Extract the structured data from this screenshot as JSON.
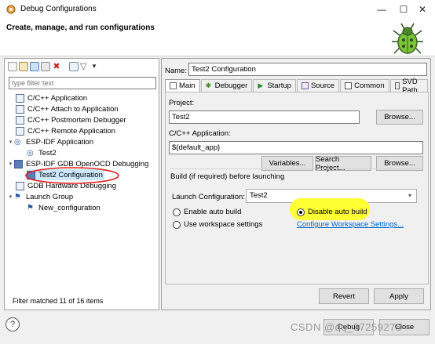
{
  "window": {
    "title": "Debug Configurations",
    "minimize": "—",
    "maximize": "☐",
    "close": "✕"
  },
  "header": {
    "title": "Create, manage, and run configurations"
  },
  "left": {
    "filter_placeholder": "type filter text",
    "tree": [
      {
        "label": "C/C++ Application",
        "level": 1
      },
      {
        "label": "C/C++ Attach to Application",
        "level": 1
      },
      {
        "label": "C/C++ Postmortem Debugger",
        "level": 1
      },
      {
        "label": "C/C++ Remote Application",
        "level": 1
      },
      {
        "label": "ESP-IDF Application",
        "level": 0,
        "expanded": true
      },
      {
        "label": "Test2",
        "level": 1
      },
      {
        "label": "ESP-IDF GDB OpenOCD Debugging",
        "level": 0,
        "expanded": true
      },
      {
        "label": "Test2 Configuration",
        "level": 1,
        "selected": true
      },
      {
        "label": "GDB Hardware Debugging",
        "level": 1
      },
      {
        "label": "Launch Group",
        "level": 0,
        "expanded": true
      },
      {
        "label": "New_configuration",
        "level": 1
      }
    ],
    "filtered_status": "Filter matched 11 of 16 items"
  },
  "right": {
    "name_label": "Name:",
    "name_value": "Test2 Configuration",
    "tabs": [
      "Main",
      "Debugger",
      "Startup",
      "Source",
      "Common",
      "SVD Path"
    ],
    "project_label": "Project:",
    "project_value": "Test2",
    "browse1": "Browse...",
    "app_label": "C/C++ Application:",
    "app_value": "${default_app}",
    "variables": "Variables...",
    "search_project": "Search Project...",
    "browse2": "Browse...",
    "build_label": "Build (if required) before launching",
    "launch_config_label": "Launch Configuration:",
    "launch_config_value": "Test2",
    "radio_enable": "Enable auto build",
    "radio_disable": "Disable auto build",
    "radio_workspace": "Use workspace settings",
    "configure_link": "Configure Workspace Settings...",
    "revert": "Revert",
    "apply": "Apply"
  },
  "footer": {
    "help": "?",
    "debug": "Debug",
    "close": "Close",
    "watermark": "CSDN @qq_37259275"
  }
}
